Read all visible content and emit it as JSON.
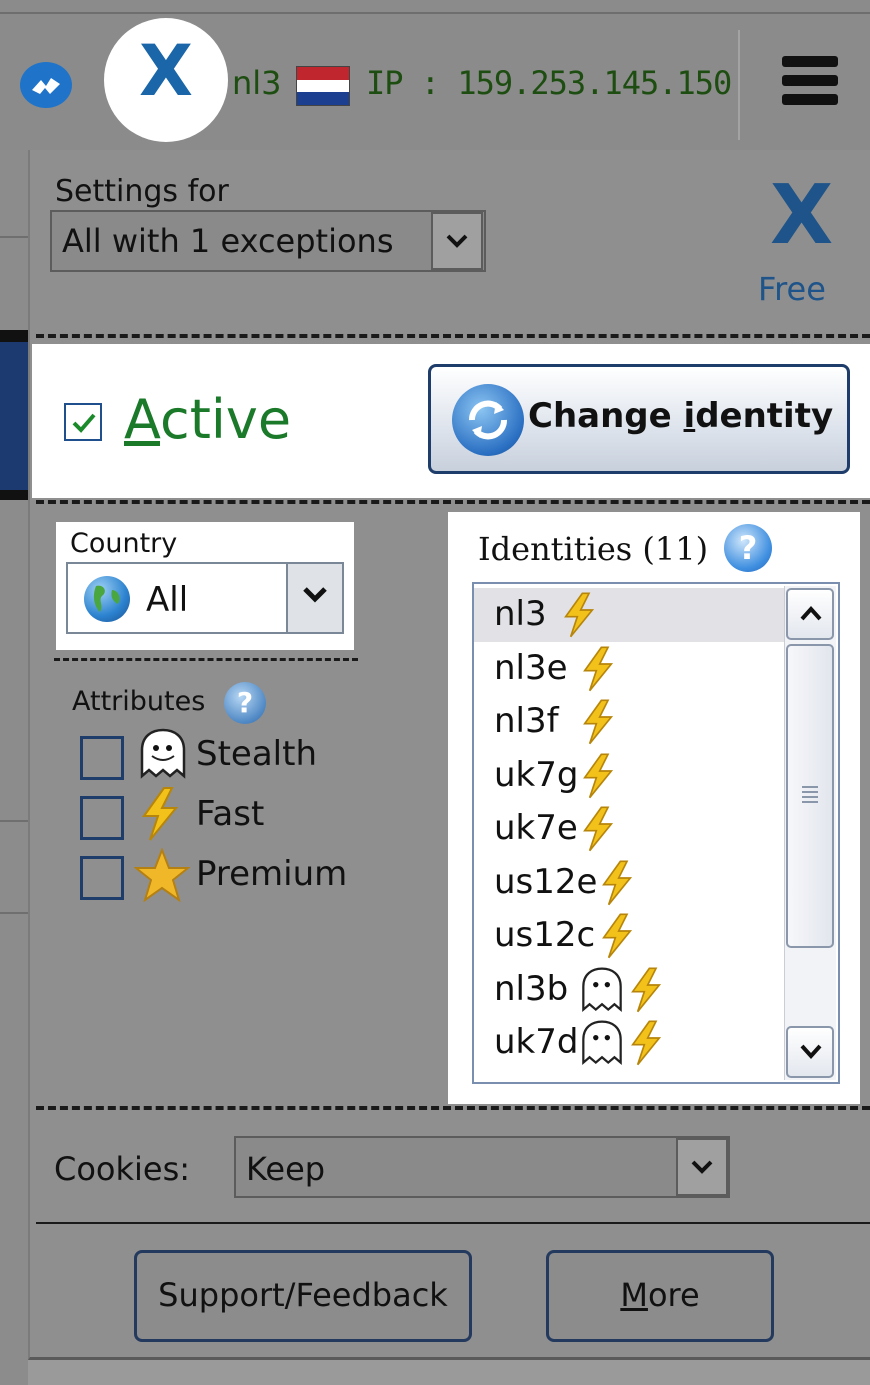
{
  "toolbar": {
    "logo_letter": "X",
    "server": "nl3",
    "ip": "IP : 159.253.145.150",
    "flag_colors": [
      "#c0262d",
      "#ffffff",
      "#1d3f8f"
    ]
  },
  "settings": {
    "label": "Settings for",
    "value": "All with 1 exceptions"
  },
  "brand": {
    "logo_letter": "X",
    "tier": "Free"
  },
  "active": {
    "checked": true,
    "label_underlined": "A",
    "label_rest": "ctive"
  },
  "change_identity": {
    "label_before": "Change ",
    "label_underlined": "i",
    "label_after": "dentity"
  },
  "country": {
    "label": "Country",
    "value": "All"
  },
  "attributes": {
    "label": "Attributes",
    "help_glyph": "?",
    "items": [
      {
        "label": "Stealth",
        "icon": "ghost-icon",
        "checked": false
      },
      {
        "label": "Fast",
        "icon": "lightning-icon",
        "checked": false
      },
      {
        "label": "Premium",
        "icon": "star-icon",
        "checked": false
      }
    ]
  },
  "identities": {
    "label": "Identities (11)",
    "help_glyph": "?",
    "selected": "nl3",
    "items": [
      {
        "name": "nl3",
        "icons": [
          "lightning-icon"
        ]
      },
      {
        "name": "nl3e",
        "icons": [
          "lightning-icon"
        ]
      },
      {
        "name": "nl3f",
        "icons": [
          "lightning-icon"
        ]
      },
      {
        "name": "uk7g",
        "icons": [
          "lightning-icon"
        ]
      },
      {
        "name": "uk7e",
        "icons": [
          "lightning-icon"
        ]
      },
      {
        "name": "us12e",
        "icons": [
          "lightning-icon"
        ]
      },
      {
        "name": "us12c",
        "icons": [
          "lightning-icon"
        ]
      },
      {
        "name": "nl3b",
        "icons": [
          "ghost-icon",
          "lightning-icon"
        ]
      },
      {
        "name": "uk7d",
        "icons": [
          "ghost-icon",
          "lightning-icon"
        ]
      }
    ]
  },
  "cookies": {
    "label": "Cookies:",
    "value": "Keep"
  },
  "buttons": {
    "support": "Support/Feedback",
    "more_underlined": "M",
    "more_rest": "ore"
  },
  "colors": {
    "active_green": "#1b7a2a",
    "brand_blue": "#1e5489",
    "ip_green": "#1d4d10"
  }
}
